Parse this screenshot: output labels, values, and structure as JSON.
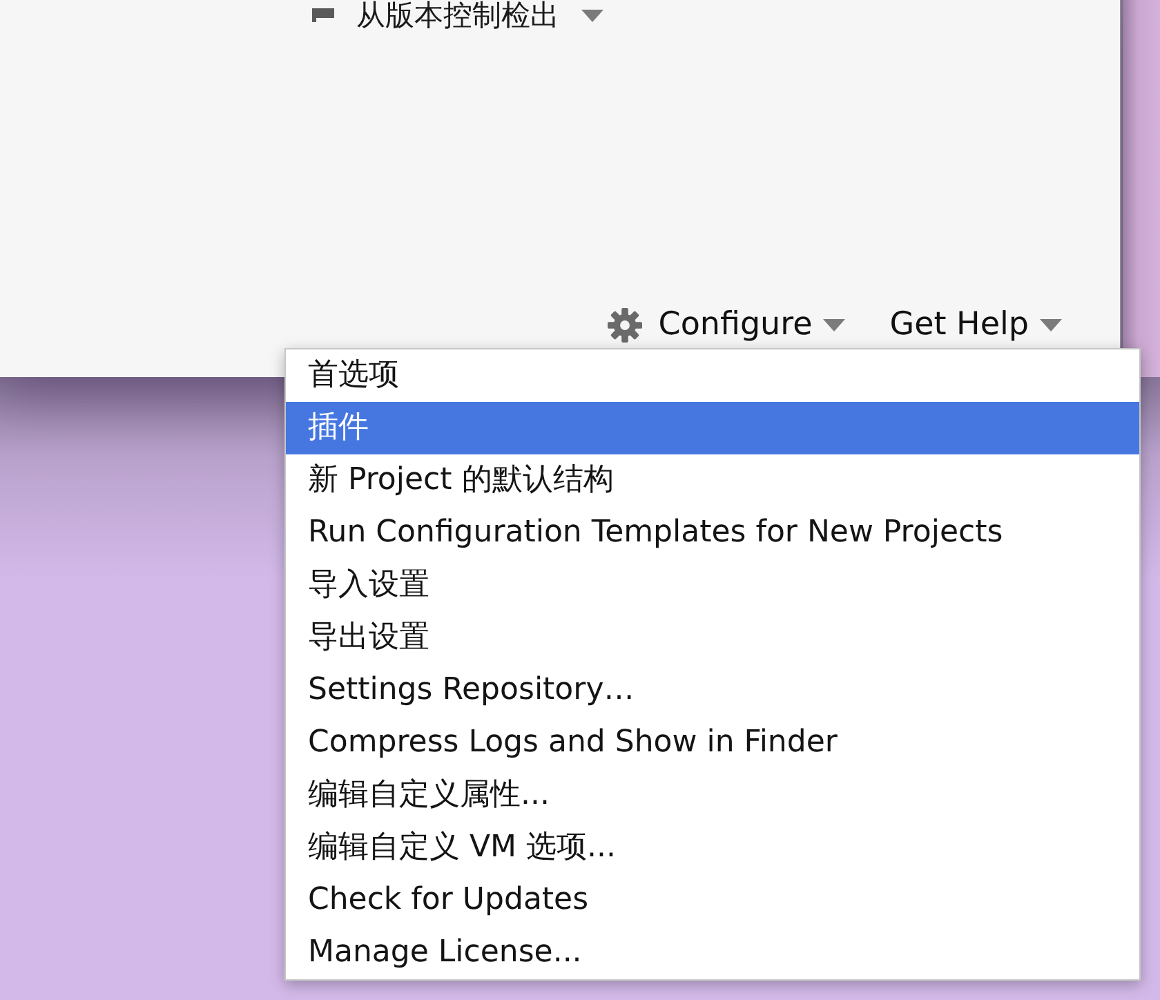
{
  "window": {
    "actions": [
      {
        "label": "从版本控制检出"
      }
    ],
    "footer": {
      "buttons": [
        {
          "label": "Configure",
          "kind": "gear"
        },
        {
          "label": "Get Help",
          "kind": "plain"
        }
      ]
    }
  },
  "menu": {
    "items": [
      {
        "label": "首选项",
        "selected": false
      },
      {
        "label": "插件",
        "selected": true
      },
      {
        "label": "新 Project 的默认结构",
        "selected": false
      },
      {
        "label": "Run Configuration Templates for New Projects",
        "selected": false
      },
      {
        "label": "导入设置",
        "selected": false
      },
      {
        "label": "导出设置",
        "selected": false
      },
      {
        "label": "Settings Repository…",
        "selected": false
      },
      {
        "label": "Compress Logs and Show in Finder",
        "selected": false
      },
      {
        "label": "编辑自定义属性...",
        "selected": false
      },
      {
        "label": "编辑自定义 VM 选项...",
        "selected": false
      },
      {
        "label": "Check for Updates",
        "selected": false
      },
      {
        "label": "Manage License...",
        "selected": false
      }
    ]
  }
}
